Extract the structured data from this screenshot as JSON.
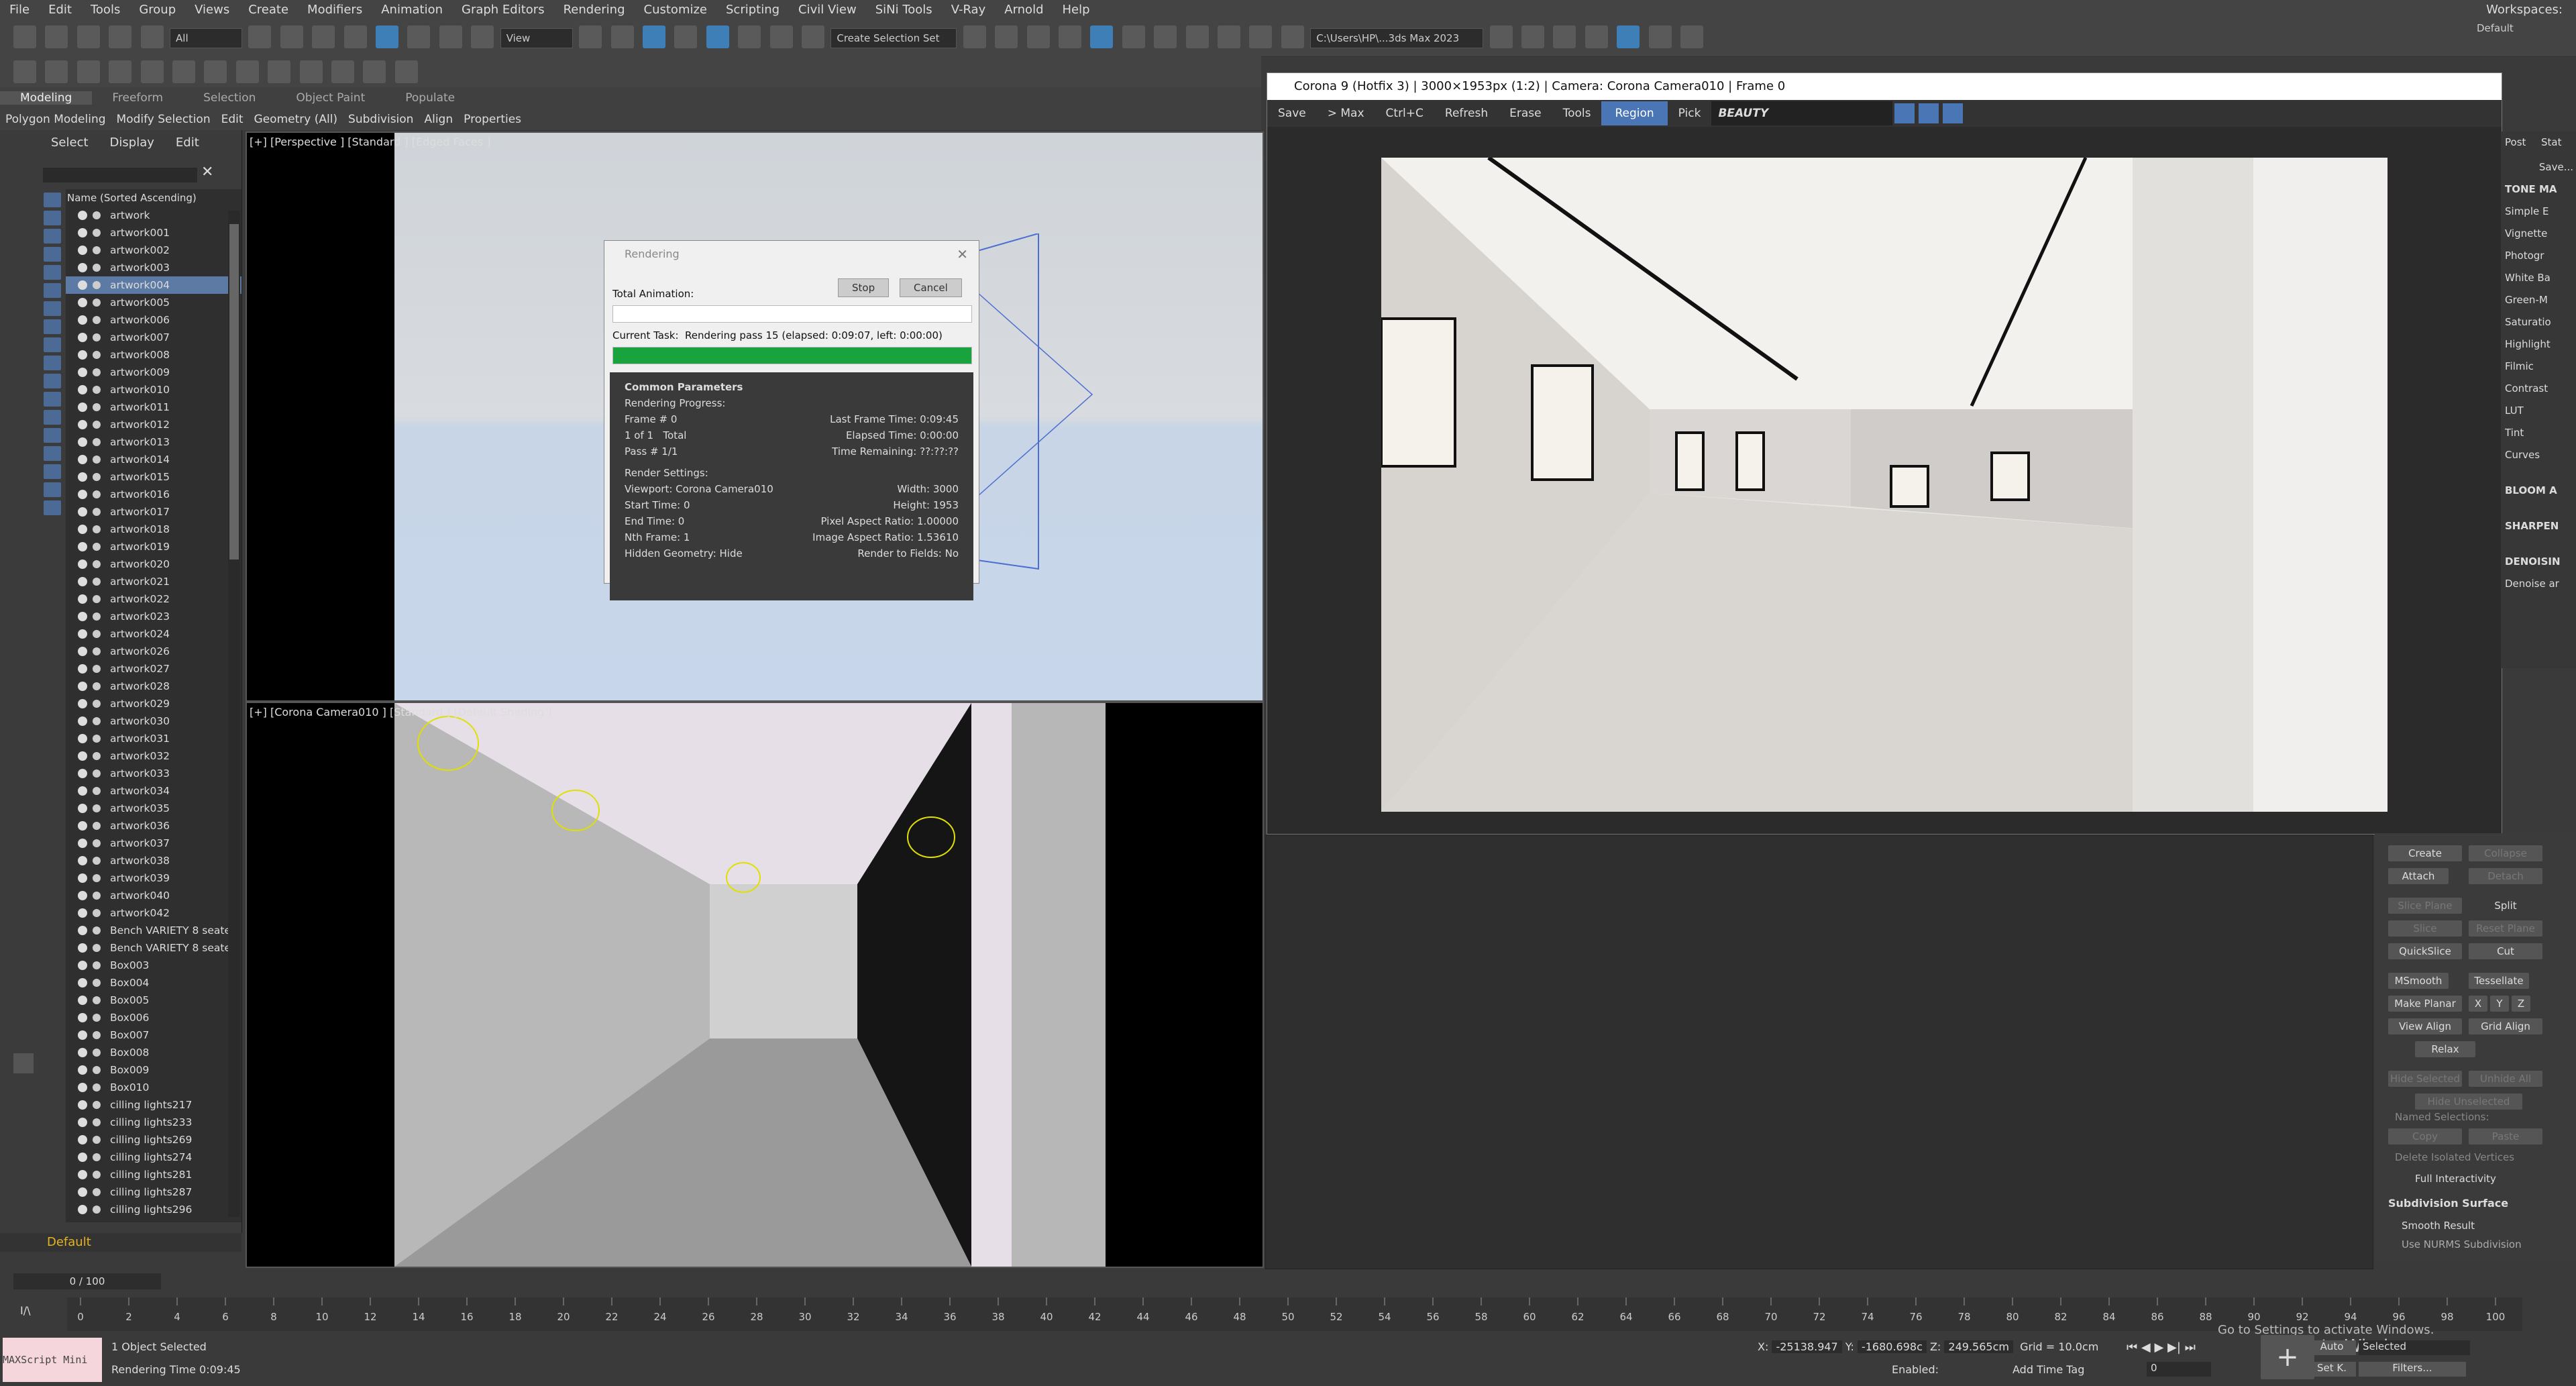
{
  "menu": {
    "items": [
      "File",
      "Edit",
      "Tools",
      "Group",
      "Views",
      "Create",
      "Modifiers",
      "Animation",
      "Graph Editors",
      "Rendering",
      "Customize",
      "Scripting",
      "Civil View",
      "SiNi Tools",
      "V-Ray",
      "Arnold",
      "Help"
    ],
    "workspaces_label": "Workspaces:",
    "workspaces_value": "Default"
  },
  "toolbar": {
    "selection_filter": "All",
    "view_combo": "View",
    "create_selection_set": "Create Selection Set",
    "project_path": "C:\\Users\\HP\\...3ds Max 2023"
  },
  "ribbon": {
    "tabs": [
      "Modeling",
      "Freeform",
      "Selection",
      "Object Paint",
      "Populate"
    ],
    "sub": [
      "Polygon Modeling",
      "Modify Selection",
      "Edit",
      "Geometry (All)",
      "Subdivision",
      "Align",
      "Properties"
    ]
  },
  "scene_explorer": {
    "tabs": [
      "Select",
      "Display",
      "Edit"
    ],
    "sort_header": "Name (Sorted Ascending)",
    "items": [
      "artwork",
      "artwork001",
      "artwork002",
      "artwork003",
      "artwork004",
      "artwork005",
      "artwork006",
      "artwork007",
      "artwork008",
      "artwork009",
      "artwork010",
      "artwork011",
      "artwork012",
      "artwork013",
      "artwork014",
      "artwork015",
      "artwork016",
      "artwork017",
      "artwork018",
      "artwork019",
      "artwork020",
      "artwork021",
      "artwork022",
      "artwork023",
      "artwork024",
      "artwork026",
      "artwork027",
      "artwork028",
      "artwork029",
      "artwork030",
      "artwork031",
      "artwork032",
      "artwork033",
      "artwork034",
      "artwork035",
      "artwork036",
      "artwork037",
      "artwork038",
      "artwork039",
      "artwork040",
      "artwork042",
      "Bench VARIETY 8 seate",
      "Bench VARIETY 8 seate",
      "Box003",
      "Box004",
      "Box005",
      "Box006",
      "Box007",
      "Box008",
      "Box009",
      "Box010",
      "cilling lights217",
      "cilling lights233",
      "cilling lights269",
      "cilling lights274",
      "cilling lights281",
      "cilling lights287",
      "cilling lights296"
    ],
    "selected_item": "artwork004",
    "layer": "Default"
  },
  "viewports": {
    "top_label": "[+] [Perspective ] [Standard ] [Edged Faces ]",
    "bottom_label": "[+] [Corona Camera010 ] [Standard ] [Default Shading ]"
  },
  "render_window": {
    "title": "Corona 9 (Hotfix 3) | 3000×1953px (1:2) | Camera: Corona Camera010 | Frame 0",
    "buttons": [
      "Save",
      "> Max",
      "Ctrl+C",
      "Refresh",
      "Erase",
      "Tools",
      "Region",
      "Pick"
    ],
    "channel": "BEAUTY",
    "side_tabs": [
      "Post",
      "Stat"
    ],
    "save_btn": "Save...",
    "tone_header": "TONE MA",
    "tone_items": [
      "Simple E",
      "Vignette",
      "Photogr",
      "White Ba",
      "Green-M",
      "Saturatio",
      "Highlight",
      "Filmic",
      "Contrast",
      "LUT",
      "Tint",
      "Curves"
    ],
    "sections": [
      "BLOOM A",
      "SHARPEN",
      "DENOISIN"
    ],
    "denoise_text": "Denoise ar"
  },
  "rendering_dialog": {
    "title": "Rendering",
    "stop": "Stop",
    "cancel": "Cancel",
    "total_animation": "Total Animation:",
    "current_task_label": "Current Task:",
    "current_task": "Rendering pass 15 (elapsed: 0:09:07, left: 0:00:00)",
    "current_progress": 1.0,
    "common_header": "Common Parameters",
    "progress_header": "Rendering Progress:",
    "frame": "Frame #  0",
    "of": "1 of 1",
    "total": "Total",
    "pass": "Pass #  1/1",
    "last_frame_time": "Last Frame Time:  0:09:45",
    "elapsed_time": "Elapsed Time:  0:00:00",
    "time_remaining": "Time Remaining:  ??:??:??",
    "render_settings": "Render Settings:",
    "viewport": "Viewport:  Corona Camera010",
    "width": "Width:  3000",
    "start_time": "Start Time:  0",
    "height": "Height:  1953",
    "end_time": "End Time:  0",
    "pixel_aspect": "Pixel Aspect Ratio:  1.00000",
    "nth_frame": "Nth Frame:  1",
    "image_aspect": "Image Aspect Ratio:  1.53610",
    "hidden_geometry": "Hidden Geometry:  Hide",
    "render_fields": "Render to Fields:  No"
  },
  "modify_panel": {
    "create": "Create",
    "collapse": "Collapse",
    "attach": "Attach",
    "detach": "Detach",
    "slice_plane": "Slice Plane",
    "split": "Split",
    "slice": "Slice",
    "reset_plane": "Reset Plane",
    "quickslice": "QuickSlice",
    "cut": "Cut",
    "msmooth": "MSmooth",
    "tessellate": "Tessellate",
    "make_planar": "Make Planar",
    "x": "X",
    "y": "Y",
    "z": "Z",
    "view_align": "View Align",
    "grid_align": "Grid Align",
    "relax": "Relax",
    "hide_selected": "Hide Selected",
    "unhide_all": "Unhide All",
    "hide_unselected": "Hide Unselected",
    "named_selections": "Named Selections:",
    "copy": "Copy",
    "paste": "Paste",
    "delete_isolated": "Delete Isolated Vertices",
    "full_interactivity": "Full Interactivity",
    "subdivision_surface": "Subdivision Surface",
    "smooth_result": "Smooth Result",
    "use_nurms": "Use NURMS Subdivision"
  },
  "timeline": {
    "frame_counter": "0 / 100",
    "ticks": [
      0,
      2,
      4,
      6,
      8,
      10,
      12,
      14,
      16,
      18,
      20,
      22,
      24,
      26,
      28,
      30,
      32,
      34,
      36,
      38,
      40,
      42,
      44,
      46,
      48,
      50,
      52,
      54,
      56,
      58,
      60,
      62,
      64,
      66,
      68,
      70,
      72,
      74,
      76,
      78,
      80,
      82,
      84,
      86,
      88,
      90,
      92,
      94,
      96,
      98,
      100
    ]
  },
  "status": {
    "maxscript": "MAXScript Mini",
    "selected": "1 Object Selected",
    "render_time": "Rendering Time  0:09:45",
    "x": "-25138.947",
    "y": "-1680.698c",
    "z": "249.565cm",
    "grid": "Grid = 10.0cm",
    "enabled": "Enabled:",
    "add_time_tag": "Add Time Tag",
    "auto": "Auto",
    "selected_combo": "Selected",
    "set_k": "Set K.",
    "filters": "Filters...",
    "frame_field": "0",
    "activate_title": "Activate Windows",
    "activate_sub": "Go to Settings to activate Windows."
  }
}
